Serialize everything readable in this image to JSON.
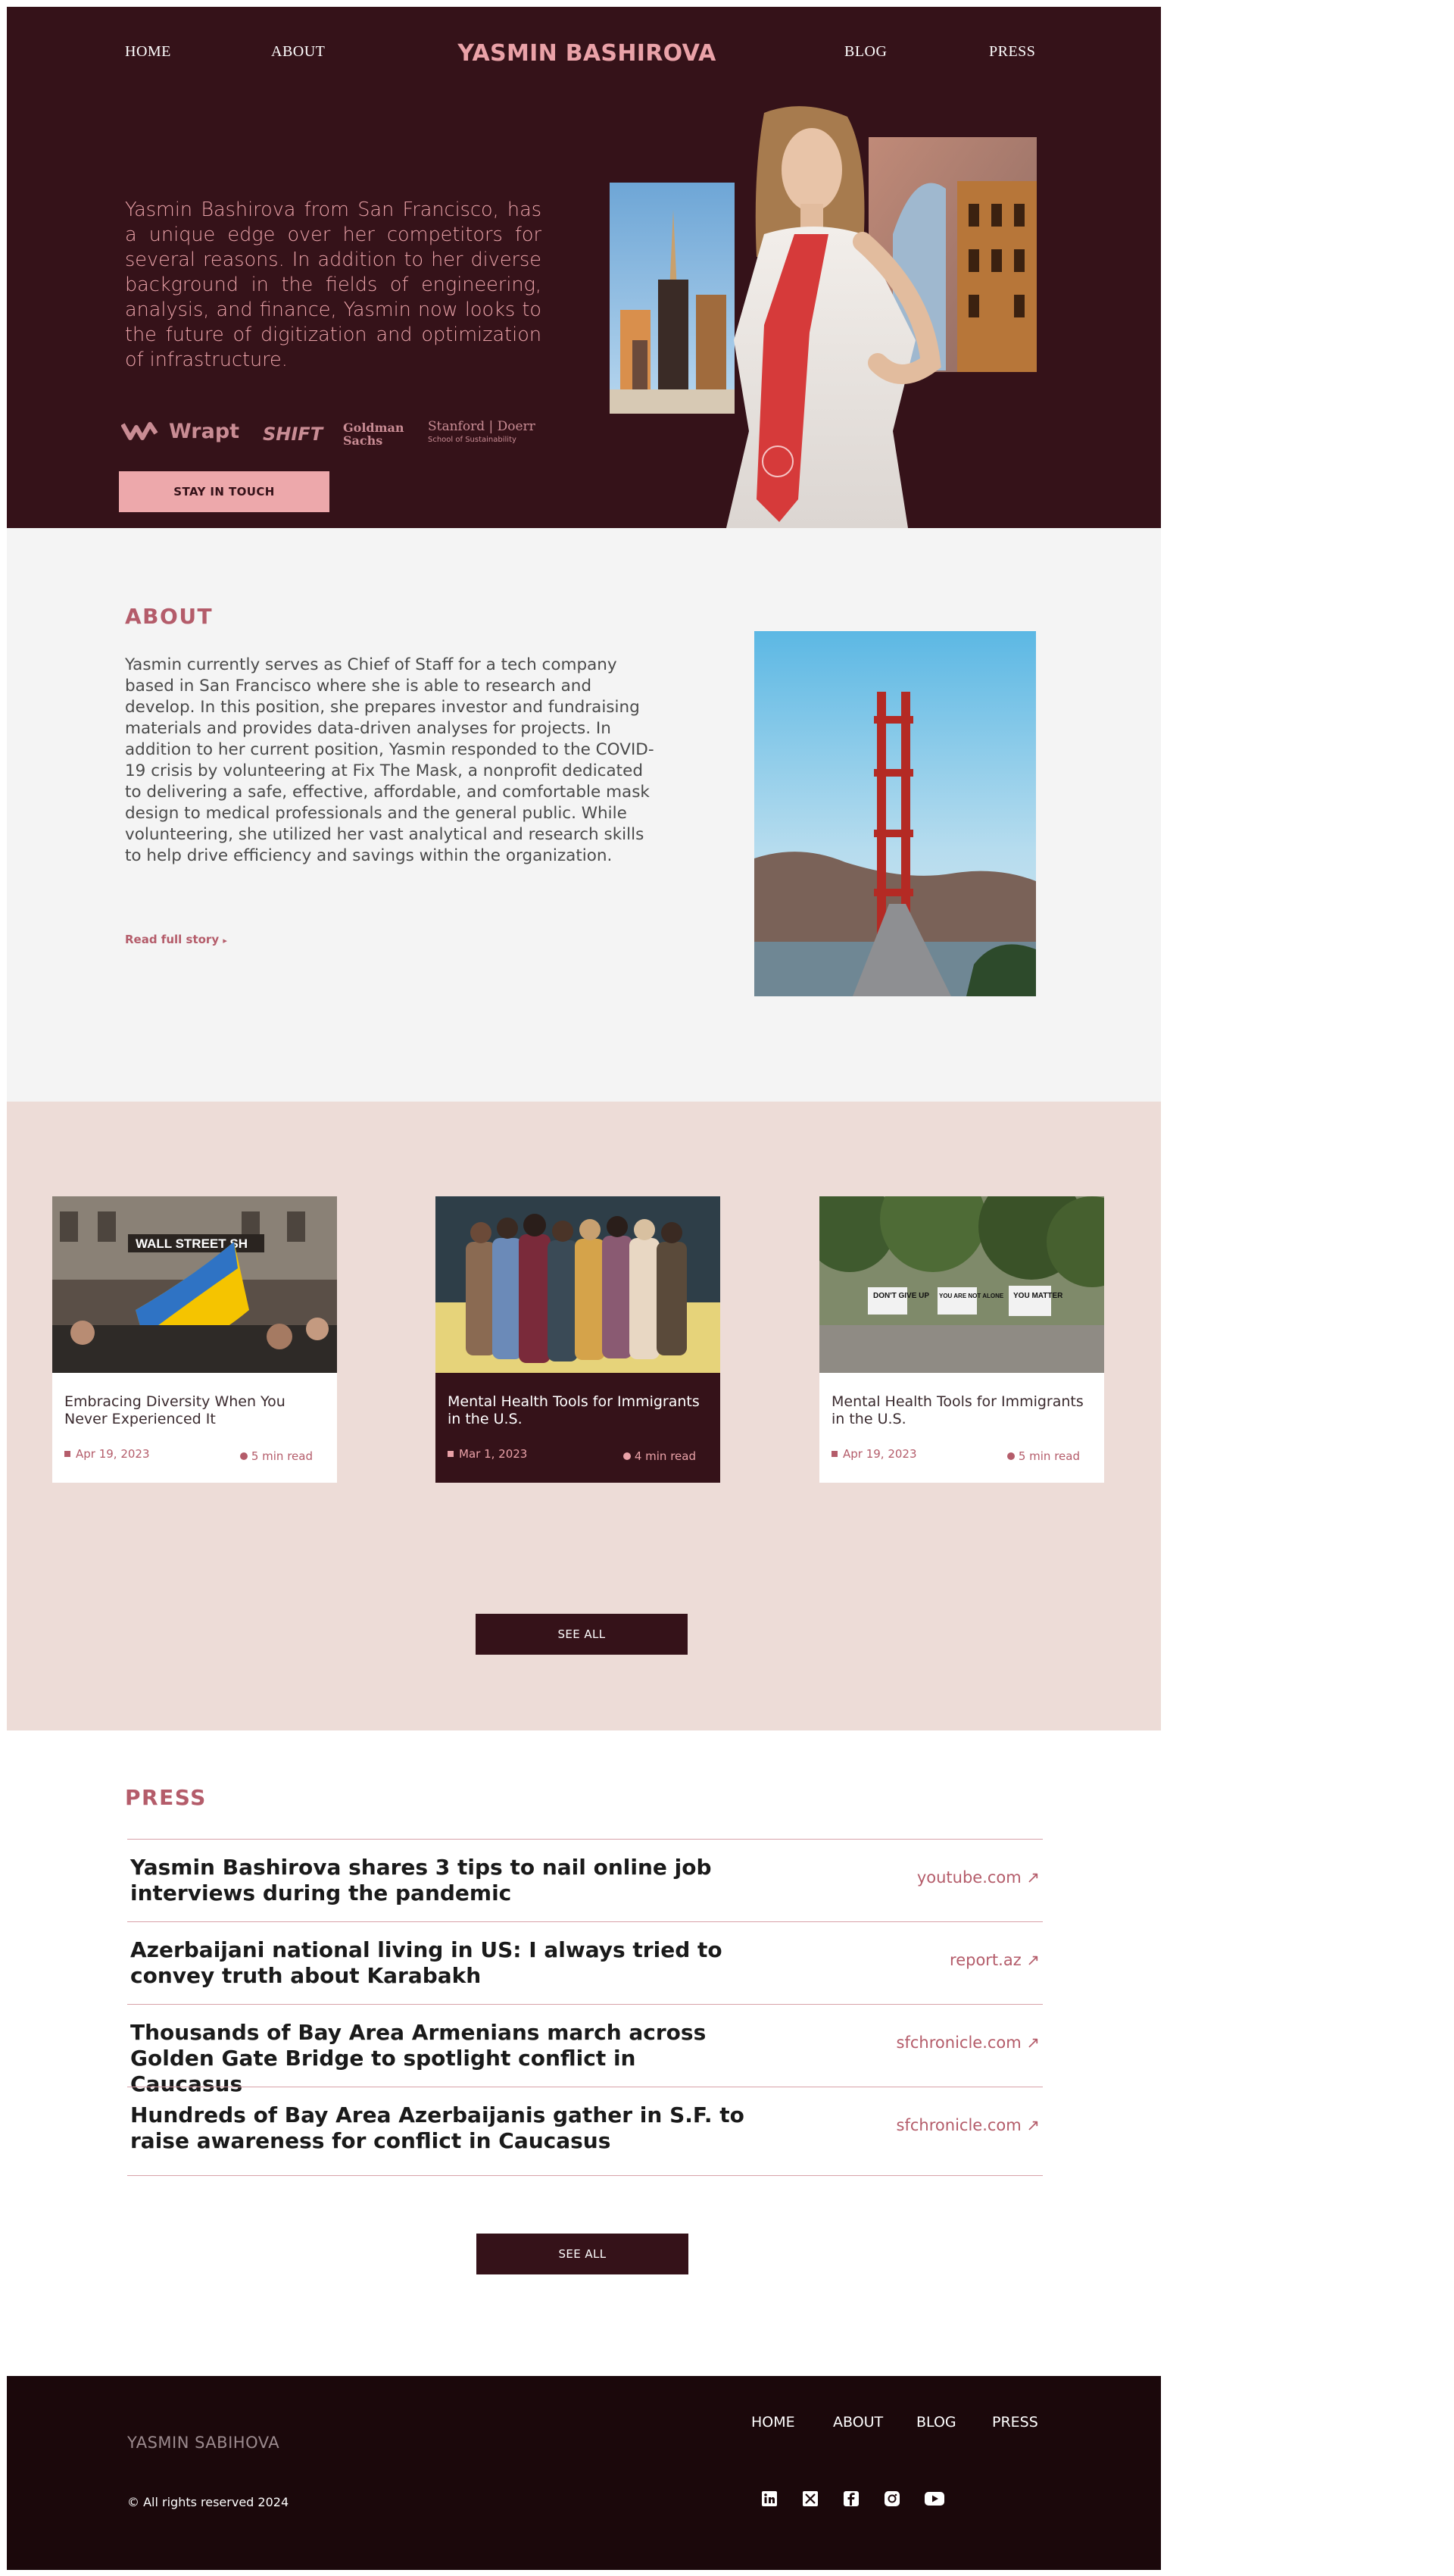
{
  "nav": {
    "home": "HOME",
    "about": "ABOUT",
    "brand": "YASMIN BASHIROVA",
    "blog": "BLOG",
    "press": "PRESS"
  },
  "hero": {
    "text": "Yasmin Bashirova from San Francisco, has a unique edge over her competitors for several reasons. In addition to her diverse background in the fields of engineering, analysis, and finance, Yasmin now looks to the future of digitization and optimization of infrastructure.",
    "logos": {
      "wrapt": "Wrapt",
      "shift": "SHIFT",
      "goldman_1": "Goldman",
      "goldman_2": "Sachs",
      "stanford": "Stanford | Doerr",
      "stanford_sub": "School of Sustainability"
    },
    "cta": "STAY IN TOUCH"
  },
  "about": {
    "title": "ABOUT",
    "text": "Yasmin currently serves as Chief of Staff for a tech company based in San Francisco where she is able to research and develop. In this position, she prepares investor and fundraising materials and provides data-driven analyses for projects. In addition to her current position, Yasmin responded to the COVID-19 crisis by volunteering at Fix The Mask, a nonprofit dedicated to delivering a safe, effective, affordable, and comfortable mask design to medical professionals and the general public. While volunteering, she utilized her vast analytical and research skills to help drive efficiency and savings within the organization.",
    "link": "Read full story",
    "link_arrow": "▸"
  },
  "blog": {
    "posts": [
      {
        "title": "Embracing Diversity When You Never Experienced It",
        "date": "Apr 19, 2023",
        "read": "5 min read",
        "sign": "WALL STREET  SH"
      },
      {
        "title": "Mental Health Tools for Immigrants in the U.S.",
        "date": "Mar 1, 2023",
        "read": "4 min read"
      },
      {
        "title": "Mental Health Tools for Immigrants in the U.S.",
        "date": "Apr 19, 2023",
        "read": "5 min read",
        "signs": [
          "DON'T GIVE UP",
          "YOU ARE NOT ALONE",
          "YOU MATTER"
        ]
      }
    ],
    "see_all": "SEE ALL"
  },
  "press": {
    "title": "PRESS",
    "items": [
      {
        "title": "Yasmin Bashirova shares 3 tips to nail online job interviews during the pandemic",
        "source": "youtube.com ↗"
      },
      {
        "title": "Azerbaijani national living in US: I always tried to convey truth about Karabakh",
        "source": "report.az ↗"
      },
      {
        "title": "Thousands of Bay Area Armenians march across Golden Gate Bridge to spotlight conflict in Caucasus",
        "source": "sfchronicle.com ↗"
      },
      {
        "title": "Hundreds of Bay Area Azerbaijanis gather in S.F. to raise awareness for conflict in Caucasus",
        "source": "sfchronicle.com ↗"
      }
    ],
    "see_all": "SEE ALL"
  },
  "footer": {
    "brand": "YASMIN SABIHOVA",
    "copyright": "© All rights reserved 2024",
    "nav": {
      "home": "HOME",
      "about": "ABOUT",
      "blog": "BLOG",
      "press": "PRESS"
    },
    "social_icons": [
      "linkedin-icon",
      "x-icon",
      "facebook-icon",
      "instagram-icon",
      "youtube-icon"
    ]
  },
  "colors": {
    "maroon": "#351219",
    "pink": "#eaa2a8",
    "rose": "#b45c6a",
    "blush_bg": "#eddcd7",
    "footer_bg": "#1b080b"
  }
}
